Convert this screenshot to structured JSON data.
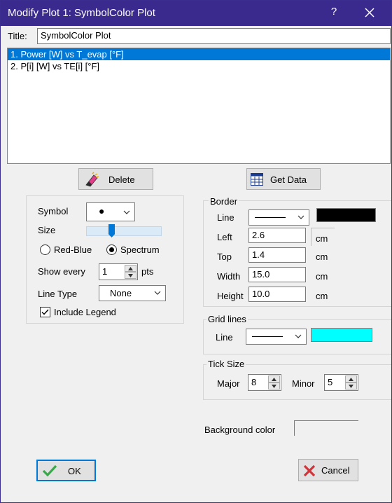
{
  "window": {
    "title": "Modify Plot 1: SymbolColor Plot",
    "help_glyph": "?"
  },
  "title_field": {
    "label": "Title:",
    "value": "SymbolColor Plot"
  },
  "plots": [
    {
      "text": "1.  Power [W] vs T_evap [°F]",
      "selected": true
    },
    {
      "text": "2.  P[i] [W] vs TE[i] [°F]",
      "selected": false
    }
  ],
  "buttons": {
    "delete": "Delete",
    "get_data": "Get Data",
    "ok": "OK",
    "cancel": "Cancel"
  },
  "symbol_panel": {
    "symbol_label": "Symbol",
    "symbol_value": "●",
    "size_label": "Size",
    "size_level": 0.32,
    "color_scheme_options": [
      "Red-Blue",
      "Spectrum"
    ],
    "color_scheme_selected": "Spectrum",
    "show_every_label": "Show every",
    "show_every_value": "1",
    "show_every_unit": "pts",
    "line_type_label": "Line Type",
    "line_type_value": "None",
    "include_legend_label": "Include Legend",
    "include_legend_checked": true
  },
  "border": {
    "group_label": "Border",
    "line_label": "Line",
    "line_color": "#000000",
    "left_label": "Left",
    "left_value": "2.6",
    "top_label": "Top",
    "top_value": "1.4",
    "width_label": "Width",
    "width_value": "15.0",
    "height_label": "Height",
    "height_value": "10.0",
    "unit": "cm"
  },
  "grid_lines": {
    "group_label": "Grid lines",
    "line_label": "Line",
    "line_color": "#00ffff"
  },
  "tick_size": {
    "group_label": "Tick Size",
    "major_label": "Major",
    "major_value": "8",
    "minor_label": "Minor",
    "minor_value": "5"
  },
  "background": {
    "label": "Background color",
    "color": "#f0f0f0"
  },
  "icons": {
    "delete": "eraser-icon",
    "get_data": "data-table-icon",
    "ok": "checkmark-icon",
    "cancel": "x-mark-icon"
  },
  "colors": {
    "titlebar": "#3b2a8d",
    "selection": "#0078d7",
    "check_green": "#3aa84a",
    "cancel_red": "#d0343a"
  }
}
